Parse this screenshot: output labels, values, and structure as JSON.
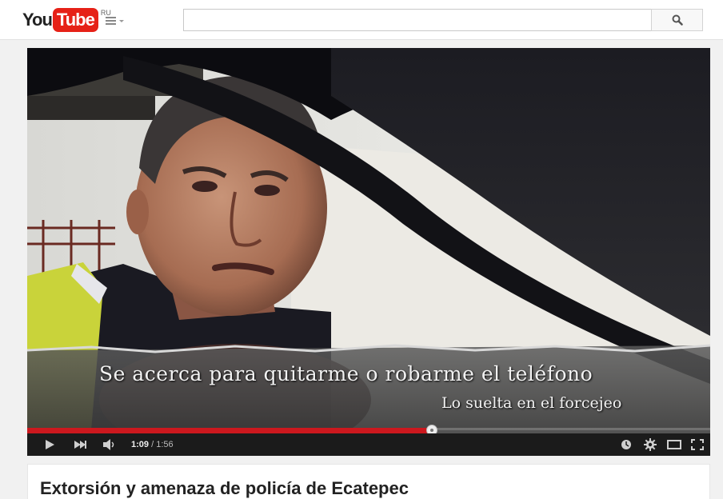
{
  "header": {
    "logo_you": "You",
    "logo_tube": "Tube",
    "country_code": "RU",
    "search": {
      "value": "",
      "placeholder": ""
    },
    "icons": {
      "guide": "menu-icon",
      "search": "search-icon"
    }
  },
  "player": {
    "subtitles": {
      "line1": "Se acerca para quitarme o robarme el teléfono",
      "line2": "Lo suelta en el forcejeo"
    },
    "time_current": "1:09",
    "time_separator": "/",
    "time_total": "1:56",
    "progress": 0.593,
    "controls": [
      "play-icon",
      "next-icon",
      "volume-icon",
      "watch-later-icon",
      "settings-icon",
      "theater-mode-icon",
      "fullscreen-icon"
    ],
    "colors": {
      "progress_played": "#cc181e",
      "brand": "#e62117"
    }
  },
  "video": {
    "title": "Extorsión y amenaza de policía de Ecatepec"
  }
}
